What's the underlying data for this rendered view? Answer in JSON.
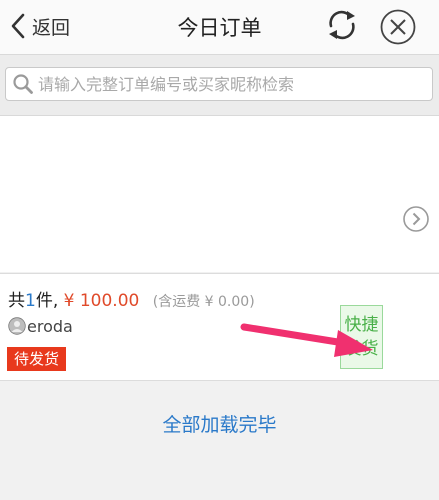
{
  "header": {
    "back_label": "返回",
    "title": "今日订单"
  },
  "search": {
    "placeholder": "请输入完整订单编号或买家昵称检索"
  },
  "order": {
    "qty_prefix": "共",
    "qty_value": "1",
    "qty_suffix": "件,",
    "price": "¥ 100.00",
    "shipping": "(含运费 ¥ 0.00)",
    "seller": "eroda",
    "status": "待发货",
    "ship_line1": "快捷",
    "ship_line2": "发货"
  },
  "footer": {
    "text": "全部加载完毕"
  },
  "colors": {
    "accent_blue": "#2a79c9",
    "price_red": "#e04a2a",
    "status_red": "#e8391d",
    "ship_green": "#49b048",
    "arrow_pink": "#f0306f"
  }
}
